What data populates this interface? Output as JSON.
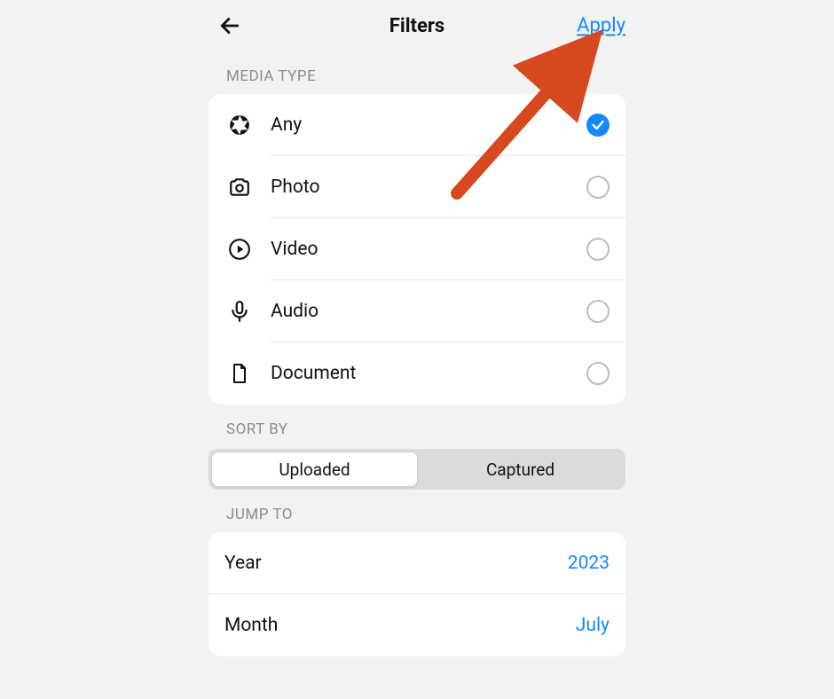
{
  "header": {
    "title": "Filters",
    "apply_label": "Apply"
  },
  "sections": {
    "media_type_label": "MEDIA TYPE",
    "sort_by_label": "SORT BY",
    "jump_to_label": "JUMP TO"
  },
  "media_types": {
    "any": "Any",
    "photo": "Photo",
    "video": "Video",
    "audio": "Audio",
    "document": "Document",
    "selected": "any"
  },
  "sort_by": {
    "uploaded": "Uploaded",
    "captured": "Captured",
    "selected": "uploaded"
  },
  "jump_to": {
    "year_label": "Year",
    "year_value": "2023",
    "month_label": "Month",
    "month_value": "July"
  },
  "colors": {
    "accent": "#1489fe",
    "arrow": "#d7481f"
  }
}
